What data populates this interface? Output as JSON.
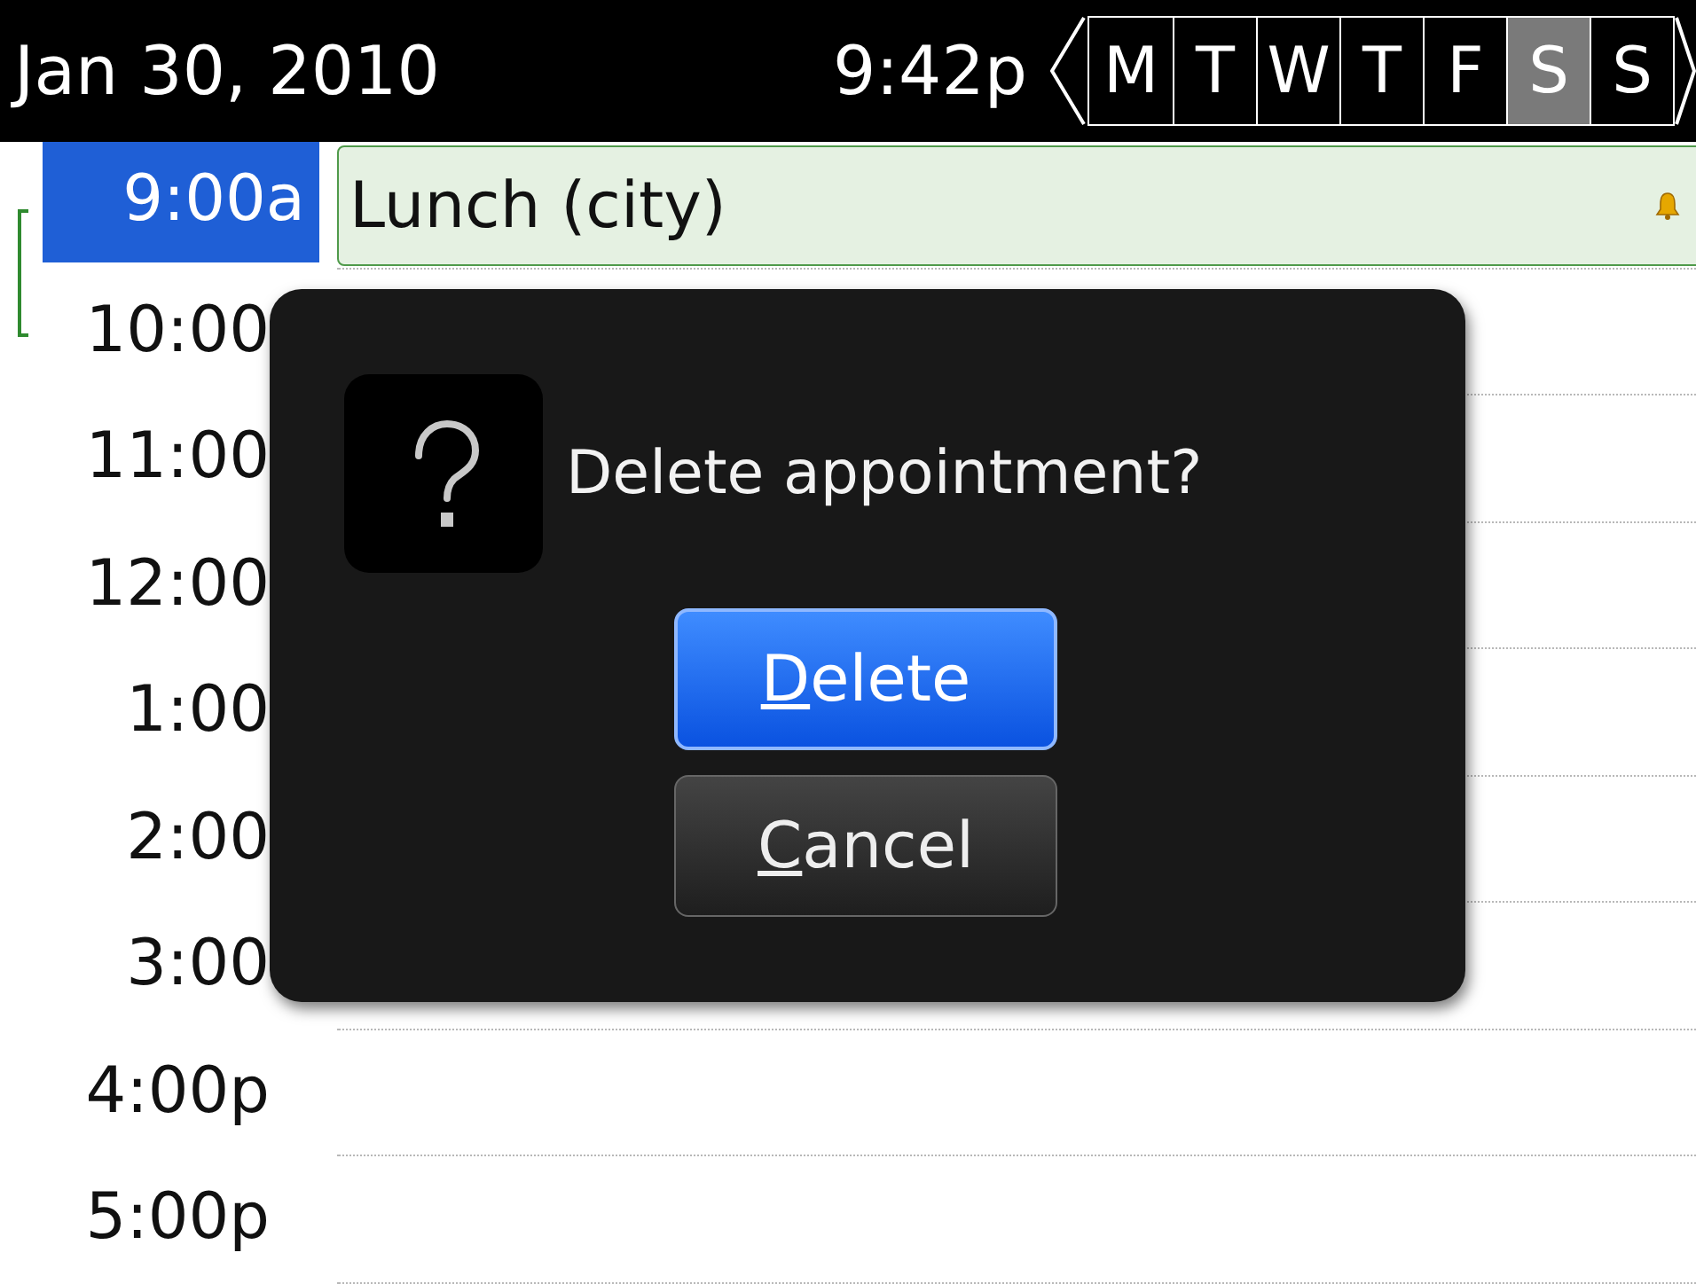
{
  "header": {
    "date": "Jan 30, 2010",
    "time": "9:42p",
    "days": [
      {
        "label": "M",
        "selected": false
      },
      {
        "label": "T",
        "selected": false
      },
      {
        "label": "W",
        "selected": false
      },
      {
        "label": "T",
        "selected": false
      },
      {
        "label": "F",
        "selected": false
      },
      {
        "label": "S",
        "selected": true
      },
      {
        "label": "S",
        "selected": false
      }
    ]
  },
  "rows": [
    {
      "time": "9:00a",
      "selected": true,
      "event": {
        "title": "Lunch (city)",
        "alarm": true
      }
    },
    {
      "time": "10:00",
      "selected": false
    },
    {
      "time": "11:00",
      "selected": false
    },
    {
      "time": "12:00",
      "selected": false
    },
    {
      "time": "1:00",
      "selected": false
    },
    {
      "time": "2:00",
      "selected": false
    },
    {
      "time": "3:00",
      "selected": false
    },
    {
      "time": "4:00p",
      "selected": false
    },
    {
      "time": "5:00p",
      "selected": false
    }
  ],
  "dialog": {
    "message": "Delete appointment?",
    "buttons": [
      {
        "label": "Delete",
        "first_letter_underlined": true,
        "selected": true
      },
      {
        "label": "Cancel",
        "first_letter_underlined": true,
        "selected": false
      }
    ]
  }
}
